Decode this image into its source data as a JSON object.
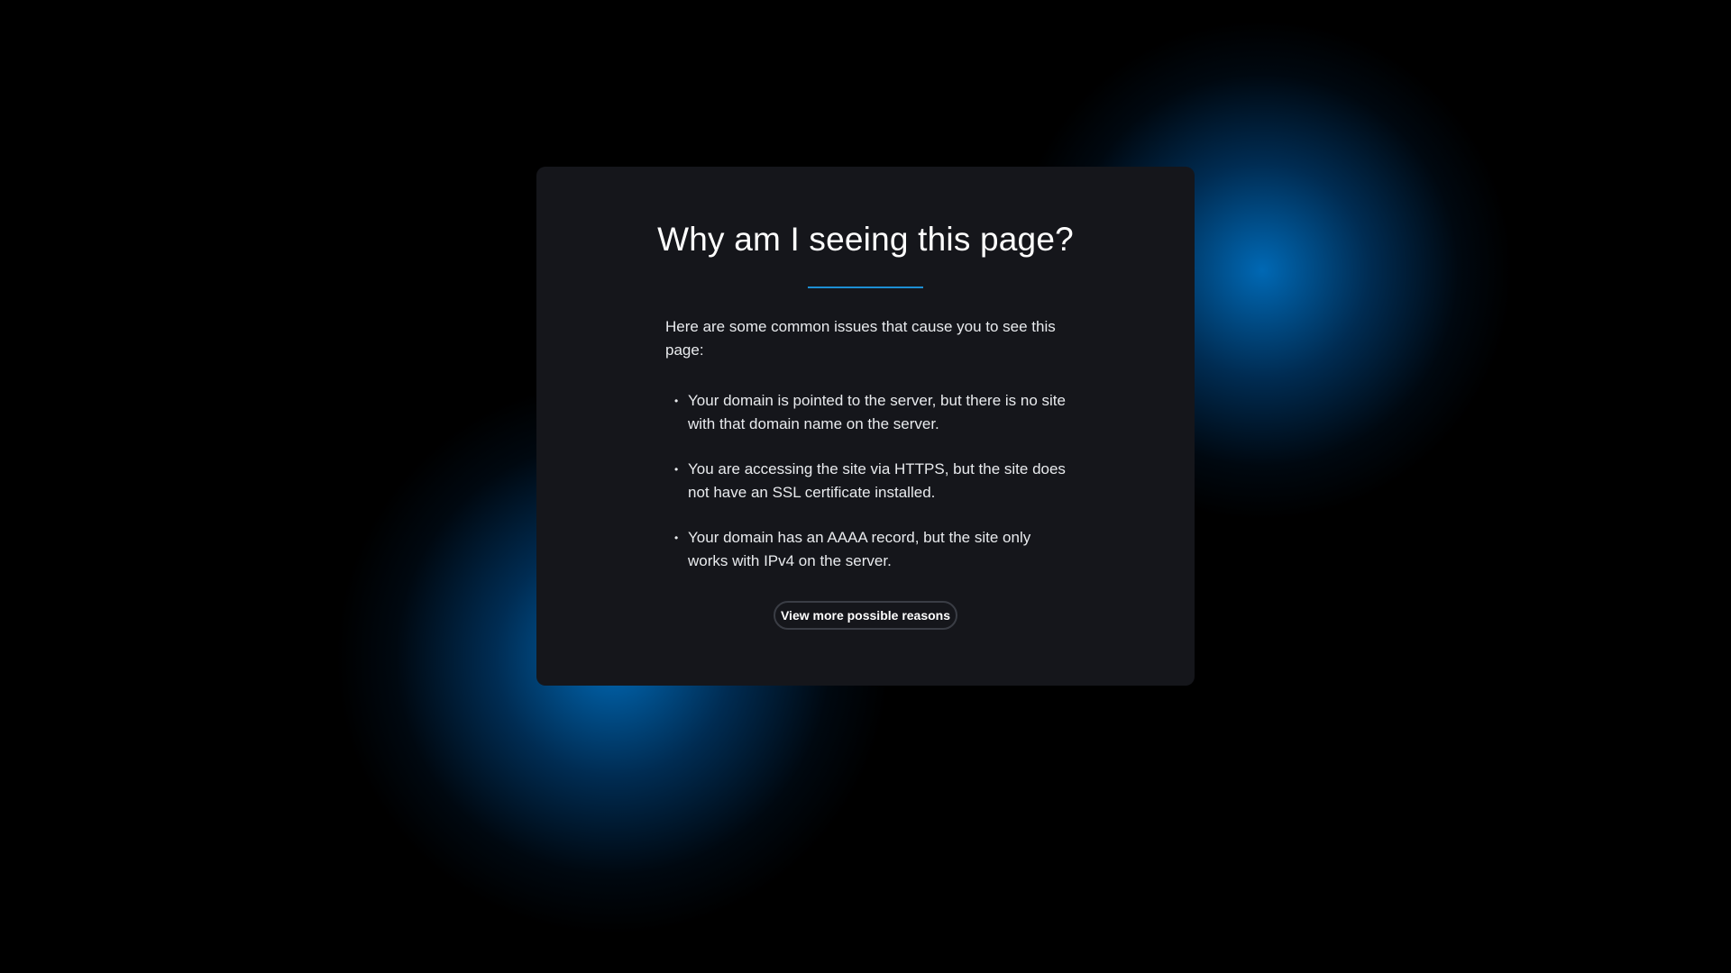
{
  "card": {
    "title": "Why am I seeing this page?",
    "intro": "Here are some common issues that cause you to see this page:",
    "reasons": [
      "Your domain is pointed to the server, but there is no site with that domain name on the server.",
      "You are accessing the site via HTTPS, but the site does not have an SSL certificate installed.",
      "Your domain has an AAAA record, but the site only works with IPv4 on the server."
    ],
    "more_button_label": "View more possible reasons"
  },
  "colors": {
    "background": "#000000",
    "card": "#15161b",
    "accent": "#1d8fd3",
    "glow": "#0070c0"
  }
}
